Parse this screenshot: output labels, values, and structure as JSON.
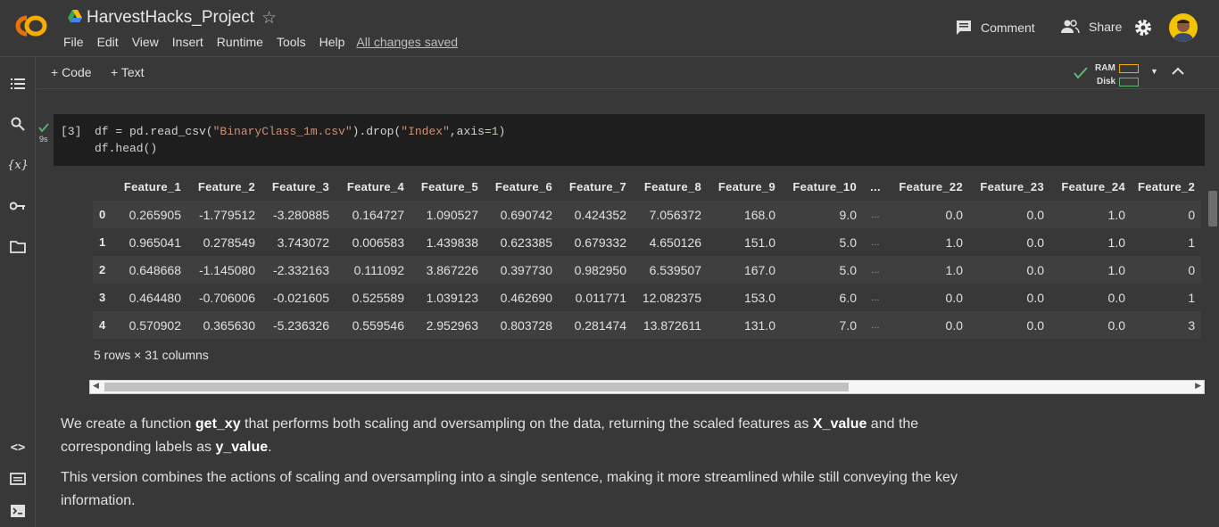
{
  "header": {
    "title": "HarvestHacks_Project",
    "menu": [
      "File",
      "Edit",
      "View",
      "Insert",
      "Runtime",
      "Tools",
      "Help"
    ],
    "saved_status": "All changes saved",
    "comment_label": "Comment",
    "share_label": "Share"
  },
  "toolbar": {
    "add_code": "+ Code",
    "add_text": "+ Text",
    "ram_label": "RAM",
    "disk_label": "Disk"
  },
  "cell": {
    "exec_count": "[3]",
    "run_time": "9s",
    "code_line_1_var": "df = pd.read_csv(",
    "code_line_1_str": "\"BinaryClass_1m.csv\"",
    "code_line_1_mid": ").drop(",
    "code_line_1_str2": "\"Index\"",
    "code_line_1_axis": ",axis=",
    "code_line_1_num": "1",
    "code_line_2": "df.head()"
  },
  "table": {
    "columns": [
      "",
      "Feature_1",
      "Feature_2",
      "Feature_3",
      "Feature_4",
      "Feature_5",
      "Feature_6",
      "Feature_7",
      "Feature_8",
      "Feature_9",
      "Feature_10",
      "...",
      "Feature_22",
      "Feature_23",
      "Feature_24",
      "Feature_2"
    ],
    "rows": [
      [
        "0",
        "0.265905",
        "-1.779512",
        "-3.280885",
        "0.164727",
        "1.090527",
        "0.690742",
        "0.424352",
        "7.056372",
        "168.0",
        "9.0",
        "...",
        "0.0",
        "0.0",
        "1.0",
        "0"
      ],
      [
        "1",
        "0.965041",
        "0.278549",
        "3.743072",
        "0.006583",
        "1.439838",
        "0.623385",
        "0.679332",
        "4.650126",
        "151.0",
        "5.0",
        "...",
        "1.0",
        "0.0",
        "1.0",
        "1"
      ],
      [
        "2",
        "0.648668",
        "-1.145080",
        "-2.332163",
        "0.111092",
        "3.867226",
        "0.397730",
        "0.982950",
        "6.539507",
        "167.0",
        "5.0",
        "...",
        "1.0",
        "0.0",
        "1.0",
        "0"
      ],
      [
        "3",
        "0.464480",
        "-0.706006",
        "-0.021605",
        "0.525589",
        "1.039123",
        "0.462690",
        "0.011771",
        "12.082375",
        "153.0",
        "6.0",
        "...",
        "0.0",
        "0.0",
        "0.0",
        "1"
      ],
      [
        "4",
        "0.570902",
        "0.365630",
        "-5.236326",
        "0.559546",
        "2.952963",
        "0.803728",
        "0.281474",
        "13.872611",
        "131.0",
        "7.0",
        "...",
        "0.0",
        "0.0",
        "0.0",
        "3"
      ]
    ],
    "shape_info": "5 rows × 31 columns"
  },
  "text_cell": {
    "p1_a": "We create a function ",
    "p1_b": "get_xy",
    "p1_c": " that performs both scaling and oversampling on the data, returning the scaled features as ",
    "p1_d": "X_value",
    "p1_e": " and the corresponding labels as ",
    "p1_f": "y_value",
    "p1_g": ".",
    "p2": "This version combines the actions of scaling and oversampling into a single sentence, making it more streamlined while still conveying the key information."
  },
  "colors": {
    "accent_orange": "#f9ab00",
    "check_green": "#5bb974"
  }
}
